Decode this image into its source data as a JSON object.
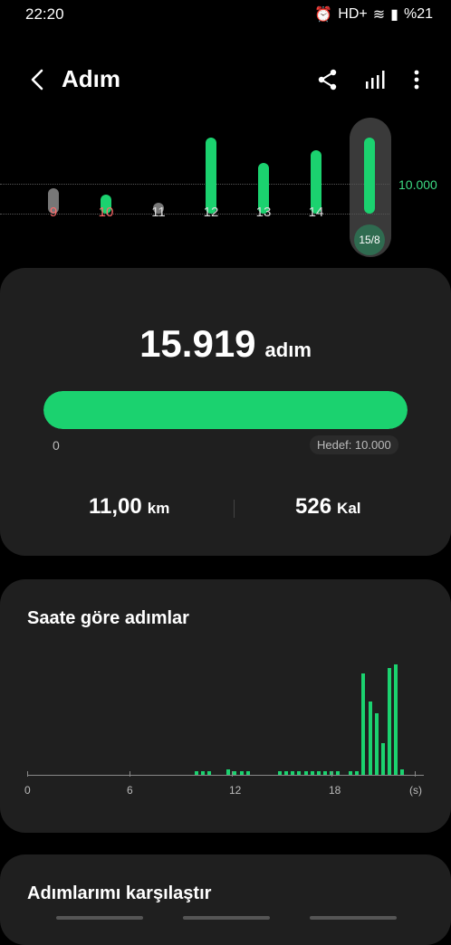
{
  "status": {
    "time": "22:20",
    "network": "HD+",
    "battery": "%21"
  },
  "header": {
    "title": "Adım"
  },
  "week": {
    "goal_label": "10.000",
    "days": [
      {
        "label": "9",
        "value": 2200,
        "red": true
      },
      {
        "label": "10",
        "value": 3000,
        "red": true
      },
      {
        "label": "11",
        "value": 0,
        "red": false
      },
      {
        "label": "12",
        "value": 12000,
        "red": false
      },
      {
        "label": "13",
        "value": 8000,
        "red": false
      },
      {
        "label": "14",
        "value": 10000,
        "red": false
      },
      {
        "label": "15/8",
        "value": 15919,
        "red": false,
        "selected": true
      }
    ]
  },
  "summary": {
    "steps": "15.919",
    "unit": "adım",
    "progress": 1.0,
    "zero": "0",
    "goal": "Hedef: 10.000",
    "distance": "11,00",
    "distance_unit": "km",
    "calories": "526",
    "calories_unit": "Kal"
  },
  "hourly": {
    "title": "Saate göre adımlar",
    "ticks": [
      "0",
      "6",
      "12",
      "18",
      "(s)"
    ],
    "values": [
      0,
      0,
      0,
      0,
      0,
      0,
      0,
      0,
      3,
      3,
      3,
      0,
      0,
      5,
      3,
      3,
      3,
      0,
      0,
      0,
      0,
      3,
      3,
      3,
      3,
      3,
      3,
      3,
      3,
      3,
      3,
      0,
      3,
      3,
      90,
      65,
      55,
      28,
      95,
      98,
      5
    ]
  },
  "compare": {
    "title": "Adımlarımı karşılaştır"
  },
  "colors": {
    "accent": "#1bd26f",
    "red": "#ff6b6b"
  }
}
